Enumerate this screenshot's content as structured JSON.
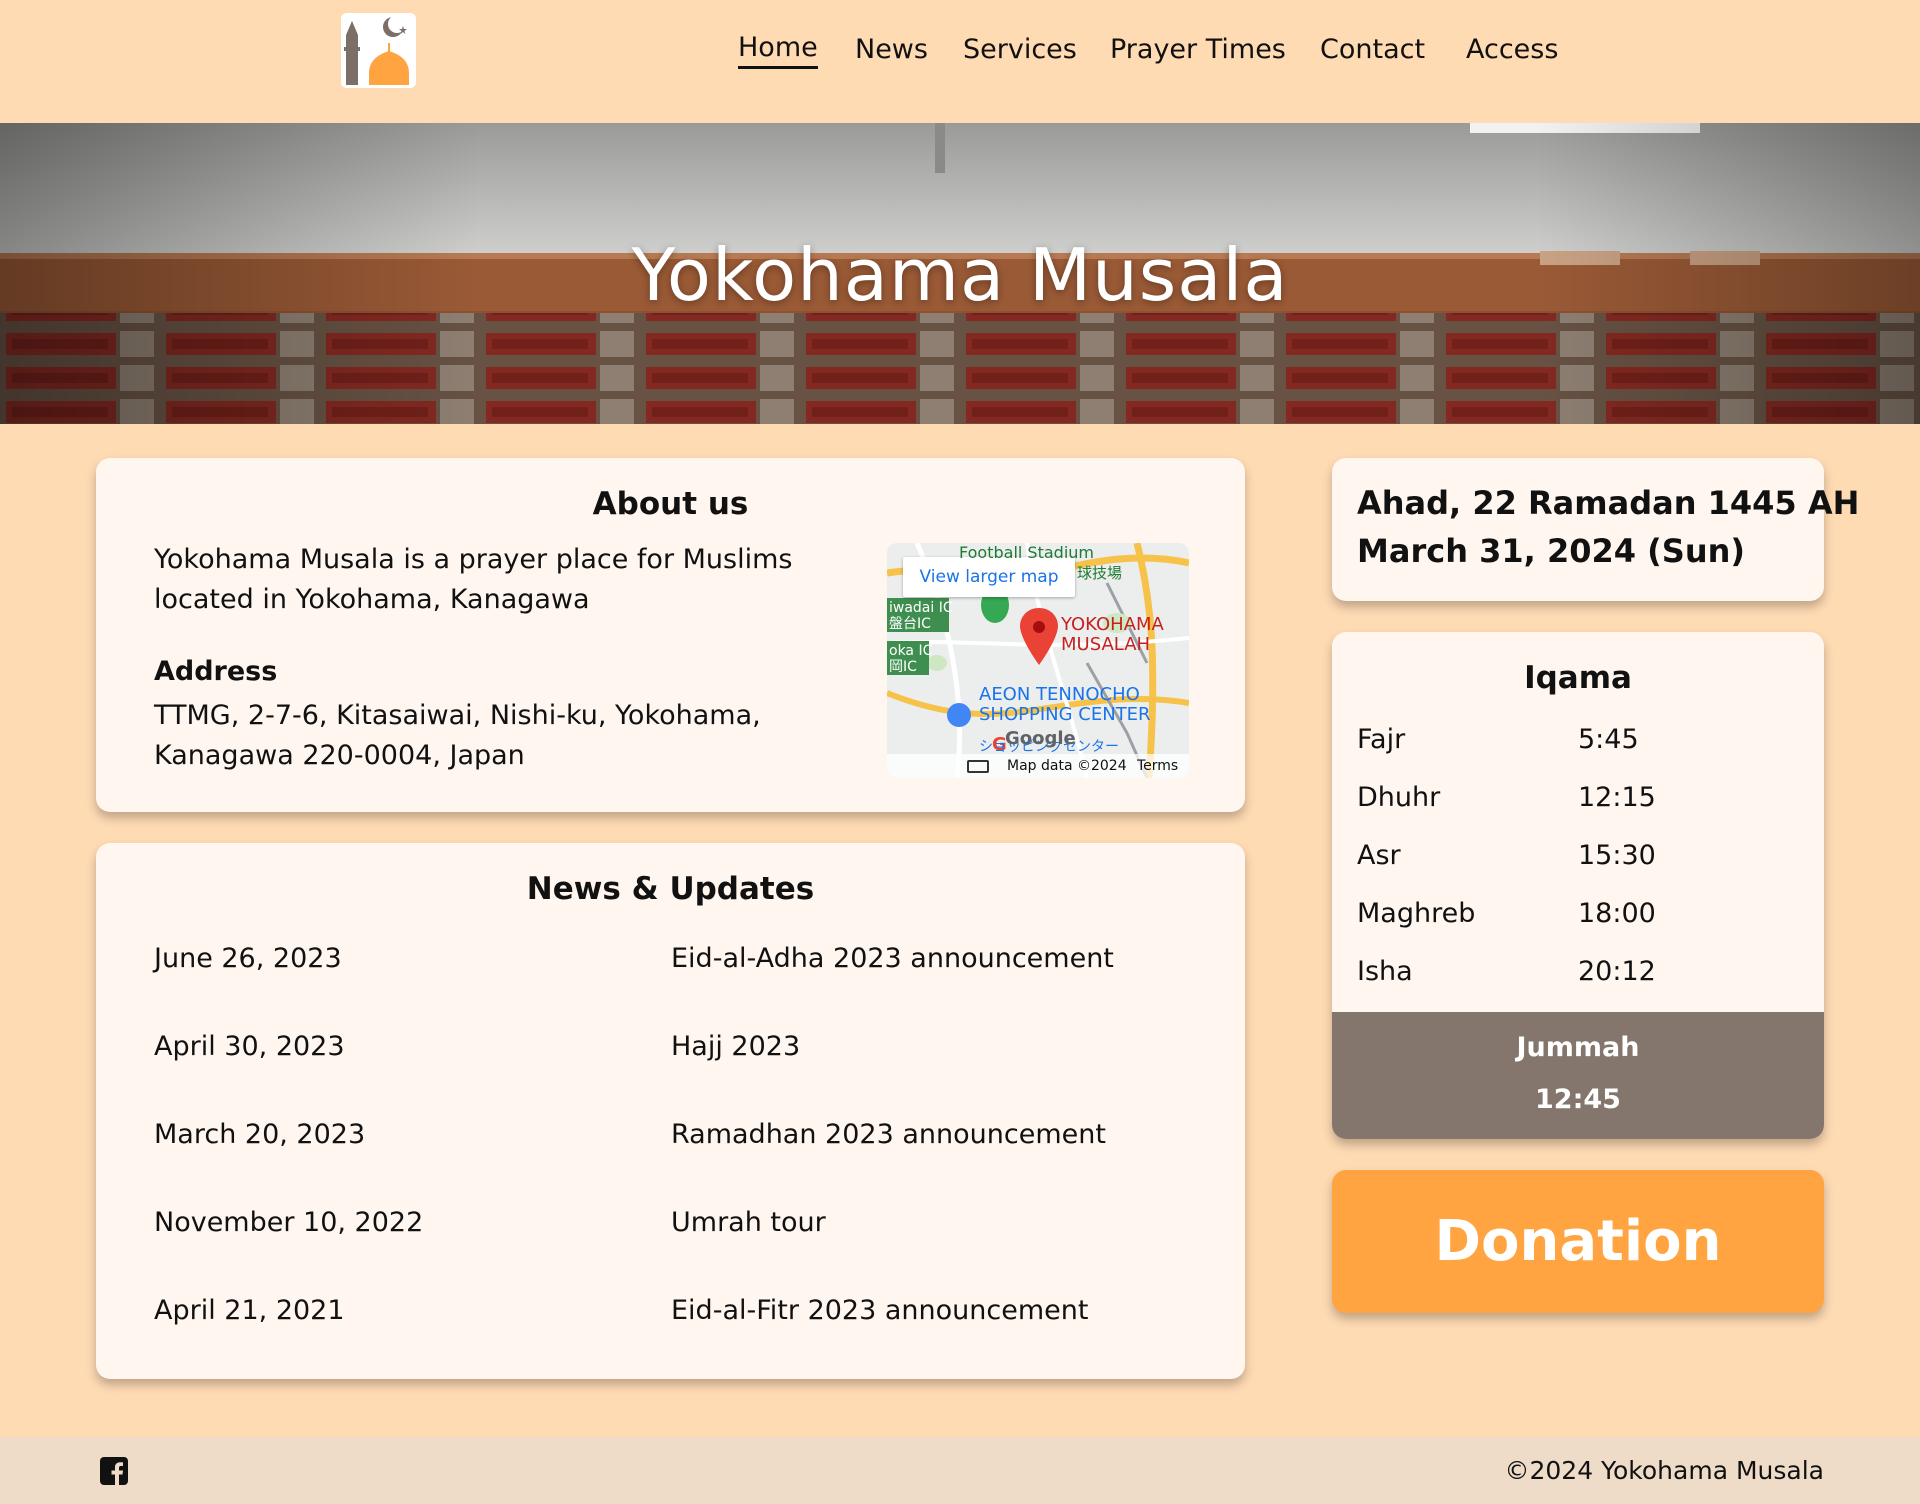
{
  "header": {
    "logo_icon": "mosque-logo-icon",
    "nav": [
      {
        "label": "Home",
        "active": true
      },
      {
        "label": "News",
        "active": false
      },
      {
        "label": "Services",
        "active": false
      },
      {
        "label": "Prayer Times",
        "active": false
      },
      {
        "label": "Contact",
        "active": false
      },
      {
        "label": "Access",
        "active": false
      }
    ]
  },
  "hero": {
    "title": "Yokohama Musala"
  },
  "about": {
    "title": "About us",
    "description": "Yokohama Musala is a prayer place for Muslims located in Yokohama, Kanagawa",
    "address_heading": "Address",
    "address": "TTMG, 2-7-6, Kitasaiwai, Nishi-ku, Yokohama, Kanagawa 220-0004, Japan",
    "map": {
      "larger_map_link": "View larger map",
      "pin_label_1": "YOKOHAMA",
      "pin_label_2": "MUSALAH",
      "place_1": "AEON TENNOCHO",
      "place_2": "SHOPPING CENTER",
      "stadium": "Football Stadium",
      "stadium_jp": "球技場",
      "ic_1": "iwadai IC",
      "ic_1_jp": "盤台IC",
      "ic_2": "oka IC",
      "ic_2_jp": "岡IC",
      "shop_jp": "ショッピングセンター",
      "logo": "Google",
      "map_data": "Map data ©2024",
      "terms": "Terms"
    }
  },
  "news": {
    "title": "News & Updates",
    "items": [
      {
        "date": "June 26, 2023",
        "title": "Eid-al-Adha 2023 announcement"
      },
      {
        "date": "April 30, 2023",
        "title": "Hajj 2023"
      },
      {
        "date": "March 20, 2023",
        "title": "Ramadhan 2023 announcement"
      },
      {
        "date": "November 10, 2022",
        "title": "Umrah tour"
      },
      {
        "date": "April 21, 2021",
        "title": "Eid-al-Fitr 2023 announcement"
      }
    ]
  },
  "date_card": {
    "hijri": "Ahad, 22 Ramadan 1445 AH",
    "gregorian": "March 31, 2024 (Sun)"
  },
  "iqama": {
    "title": "Iqama",
    "prayers": [
      {
        "name": "Fajr",
        "time": "5:45"
      },
      {
        "name": "Dhuhr",
        "time": "12:15"
      },
      {
        "name": "Asr",
        "time": "15:30"
      },
      {
        "name": "Maghreb",
        "time": "18:00"
      },
      {
        "name": "Isha",
        "time": "20:12"
      }
    ],
    "jummah_label": "Jummah",
    "jummah_time": "12:45"
  },
  "donation": {
    "label": "Donation"
  },
  "footer": {
    "social_icon": "facebook-icon",
    "copyright": "©2024 Yokohama Musala"
  },
  "colors": {
    "background": "#ffdbb4",
    "card": "#fff6ef",
    "accent": "#ffa440",
    "jummah": "#84766c",
    "footer": "#efdcc8"
  }
}
